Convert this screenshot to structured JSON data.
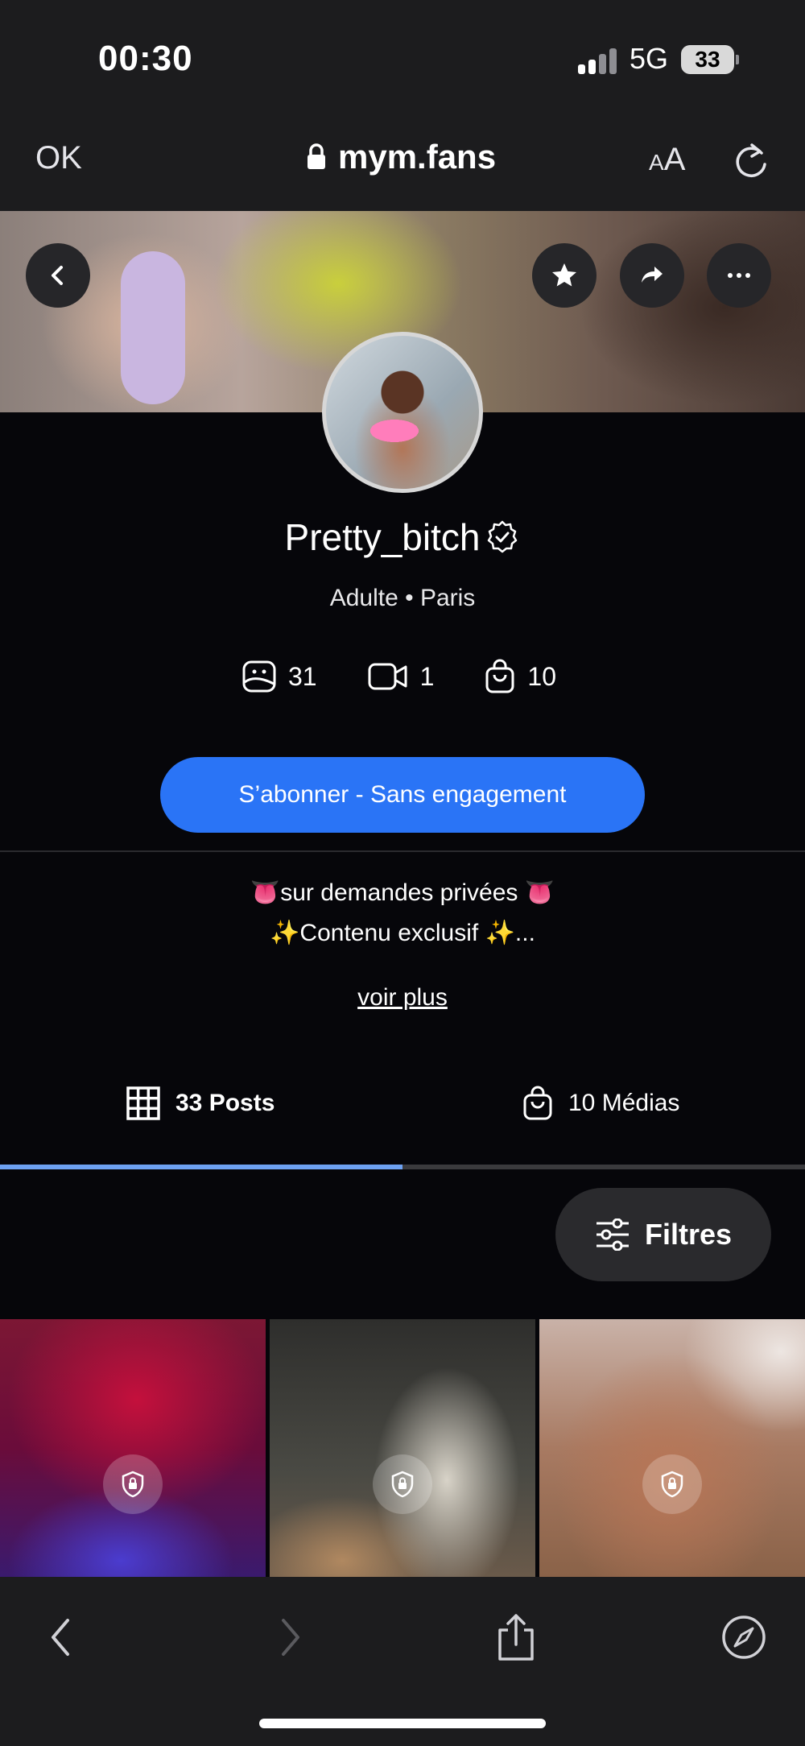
{
  "status_bar": {
    "time": "00:30",
    "network": "5G",
    "battery": "33"
  },
  "browser": {
    "done_label": "OK",
    "url": "mym.fans",
    "text_size_small": "A",
    "text_size_big": "A"
  },
  "icons": {
    "back": "chevron-left-icon",
    "favorite": "star-icon",
    "share": "share-arrow-icon",
    "more": "more-horizontal-icon",
    "verified": "verified-badge-icon",
    "photos": "photo-icon",
    "videos": "video-camera-icon",
    "bag": "shopping-bag-icon",
    "grid": "grid-icon",
    "filters": "sliders-icon",
    "lock": "lock-shield-icon",
    "browser_back": "chevron-left-icon",
    "browser_forward": "chevron-right-icon",
    "browser_share": "share-icon",
    "safari": "compass-icon"
  },
  "profile": {
    "username": "Pretty_bitch",
    "meta": "Adulte • Paris",
    "stats": {
      "photos": "31",
      "videos": "1",
      "medias": "10"
    },
    "subscribe_label": "S’abonner - Sans engagement",
    "bio_line1": "👅sur demandes privées 👅",
    "bio_line2": "✨Contenu exclusif ✨...",
    "see_more": "voir plus"
  },
  "tabs": [
    {
      "label": "33 Posts",
      "active": true
    },
    {
      "label": "10 Médias",
      "active": false
    }
  ],
  "filters_label": "Filtres",
  "colors": {
    "accent": "#2a74f6",
    "tab_indicator": "#6ea2f2",
    "background": "#06060a",
    "chrome": "#1c1c1e"
  }
}
